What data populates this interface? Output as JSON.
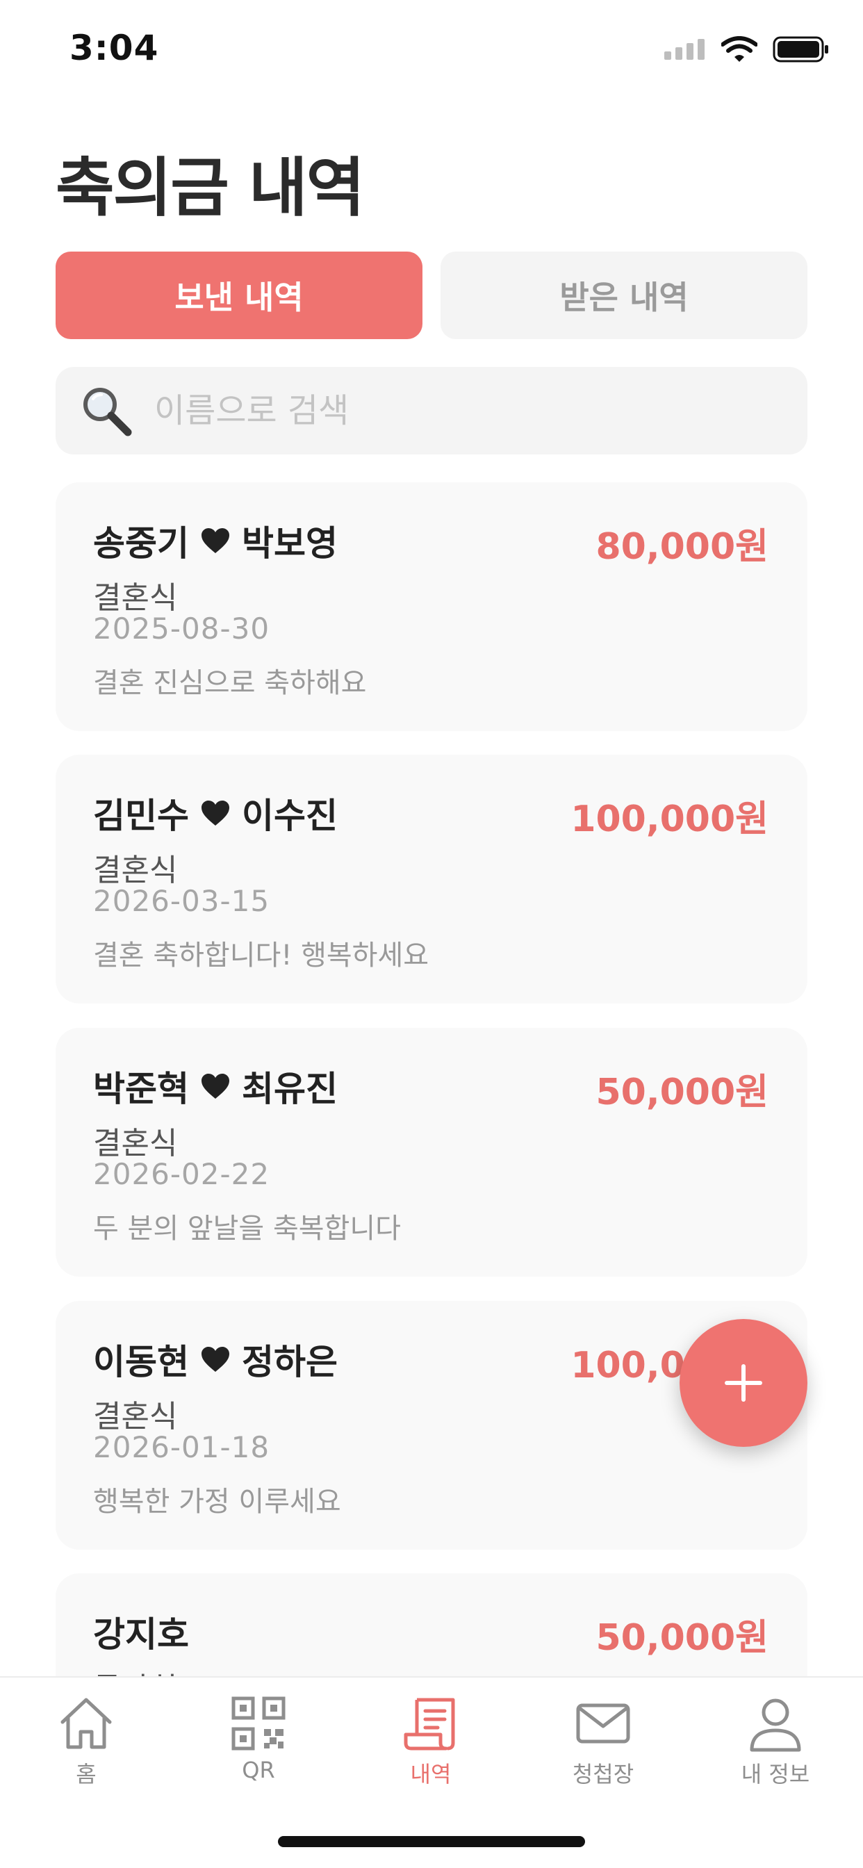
{
  "status_bar": {
    "time": "3:04"
  },
  "page_title": "축의금 내역",
  "tabs": {
    "sent": "보낸 내역",
    "received": "받은 내역"
  },
  "search": {
    "placeholder": "이름으로 검색"
  },
  "entries": [
    {
      "groom": "송중기",
      "bride": "박보영",
      "amount": "80,000원",
      "type": "결혼식",
      "date": "2025-08-30",
      "message": "결혼 진심으로 축하해요"
    },
    {
      "groom": "김민수",
      "bride": "이수진",
      "amount": "100,000원",
      "type": "결혼식",
      "date": "2026-03-15",
      "message": "결혼 축하합니다! 행복하세요"
    },
    {
      "groom": "박준혁",
      "bride": "최유진",
      "amount": "50,000원",
      "type": "결혼식",
      "date": "2026-02-22",
      "message": "두 분의 앞날을 축복합니다"
    },
    {
      "groom": "이동현",
      "bride": "정하은",
      "amount": "100,000원",
      "type": "결혼식",
      "date": "2026-01-18",
      "message": "행복한 가정 이루세요"
    },
    {
      "groom": "강지호",
      "amount": "50,000원",
      "type": "돌잔치"
    }
  ],
  "tabbar": {
    "home": "홈",
    "qr": "QR",
    "history": "내역",
    "invitation": "청첩장",
    "profile": "내 정보"
  },
  "colors": {
    "accent": "#ef7370",
    "amount": "#e8706c",
    "card_bg": "#f9f9f9"
  },
  "icons": [
    "search-icon",
    "heart-icon",
    "plus-icon",
    "home-icon",
    "qr-icon",
    "receipt-icon",
    "envelope-icon",
    "person-icon"
  ]
}
